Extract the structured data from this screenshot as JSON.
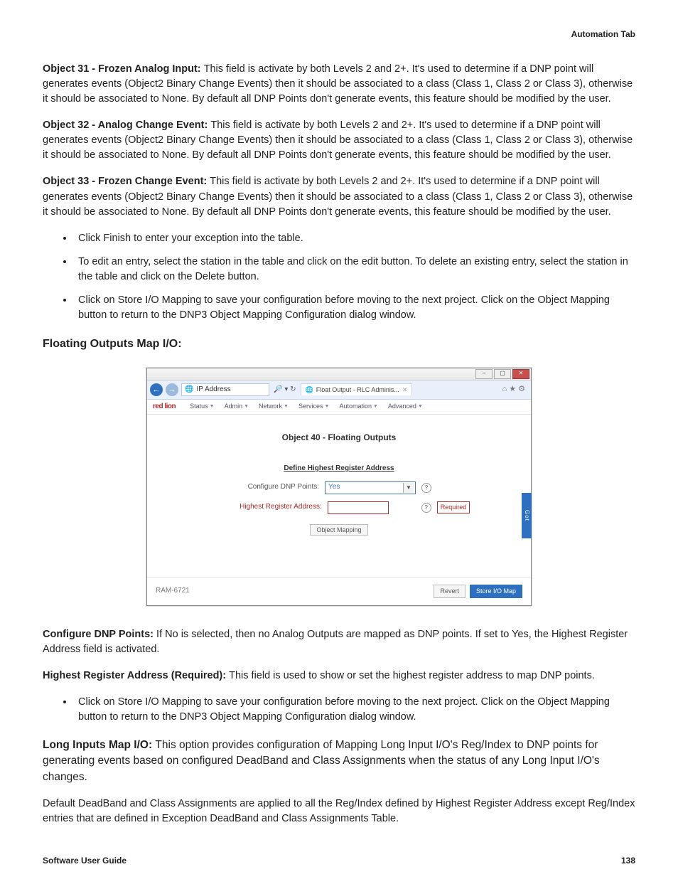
{
  "header": {
    "right": "Automation Tab"
  },
  "p1": {
    "bold": "Object 31 - Frozen Analog Input: ",
    "text": "This field is activate by both Levels 2 and 2+. It's used to determine if a DNP point will generates events (Object2 Binary Change Events) then it should be associated to a class (Class 1, Class 2 or Class 3), otherwise it should be associated to None. By default all DNP Points don't generate events, this feature should be modified by the user."
  },
  "p2": {
    "bold": "Object 32 - Analog Change Event: ",
    "text": "This field is activate by both Levels 2 and 2+. It's used to determine if a DNP point will generates events (Object2 Binary Change Events) then it should be associated to a class (Class 1, Class 2 or Class 3), otherwise it should be associated to None. By default all DNP Points don't generate events, this feature should be modified by the user."
  },
  "p3": {
    "bold": "Object 33 - Frozen Change Event: ",
    "text": "This field is activate by both Levels 2 and 2+. It's used to determine if a DNP point will generates events (Object2 Binary Change Events) then it should be associated to a class (Class 1, Class 2 or Class 3), otherwise it should be associated to None. By default all DNP Points don't generate events, this feature should be modified by the user."
  },
  "bullets_a": [
    "Click Finish to enter your exception into the table.",
    "To edit an entry, select the station in the table and click on the edit button. To delete an existing entry, select the station in the table and click on the Delete button.",
    "Click on Store I/O Mapping to save your configuration before moving to the next project. Click on the Object Mapping button to return to the DNP3 Object Mapping Configuration dialog window."
  ],
  "section_floating": "Floating Outputs Map I/O:",
  "screenshot": {
    "window_buttons": {
      "min": "–",
      "max": "▢",
      "close": "✕"
    },
    "nav": {
      "back": "←",
      "fwd": "→"
    },
    "address_label": "IP Address",
    "addr_tools": "🔎 ▾ ↻",
    "tab_title": "Float Output - RLC Adminis...",
    "tab_close": "✕",
    "right_icons": "⌂  ★  ⚙",
    "logo": "red lion",
    "menus": [
      "Status",
      "Admin",
      "Network",
      "Services",
      "Automation",
      "Advanced"
    ],
    "page_title": "Object 40 - Floating Outputs",
    "define_heading": "Define Highest Register Address",
    "row1_label": "Configure DNP Points:",
    "row1_value": "Yes",
    "row2_label": "Highest Register Address:",
    "required_badge": "Required",
    "help_glyph": "?",
    "object_mapping_btn": "Object Mapping",
    "device_id": "RAM-6721",
    "revert_btn": "Revert",
    "store_btn": "Store I/O Map",
    "feedback": "Got Feedback?"
  },
  "p_configure": {
    "bold": "Configure DNP Points: ",
    "text": "If No is selected, then no Analog Outputs are mapped as DNP points. If set to Yes, the Highest Register Address field is activated."
  },
  "p_highest": {
    "bold": "Highest Register Address (Required): ",
    "text": "This field is used to show or set the highest register address to map DNP points."
  },
  "bullets_b": [
    "Click on Store I/O Mapping to save your configuration before moving to the next project. Click on the Object Mapping button to return to the DNP3 Object Mapping Configuration dialog window."
  ],
  "p_long": {
    "bold": "Long Inputs Map I/O: ",
    "text": "This option provides configuration of Mapping Long Input I/O's Reg/Index to DNP points for generating events based on configured DeadBand and Class Assignments when the status of any Long Input I/O's changes."
  },
  "p_default": "Default DeadBand and Class Assignments are applied to all the Reg/Index defined by Highest Register Address except Reg/Index entries that are defined in Exception DeadBand and Class Assignments Table.",
  "footer": {
    "left": "Software User Guide",
    "right": "138"
  }
}
